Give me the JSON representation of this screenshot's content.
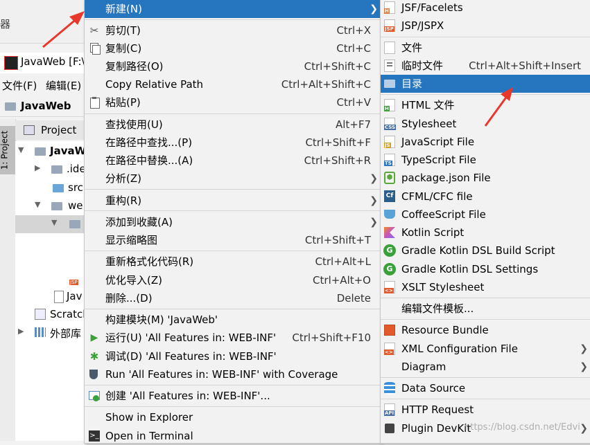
{
  "ide": {
    "top_label": "器",
    "title": "JavaWeb [F:\\",
    "menu_file": "文件(F)",
    "menu_edit": "编辑(E)",
    "nav_project": "JavaWeb",
    "project_tab": "Project",
    "stripe_label": "1: Project",
    "tree": {
      "root": "JavaW",
      "idea": ".ide",
      "src": "src",
      "web": "we",
      "java_file": "Jav",
      "scratches": "Scratch",
      "external_libs": "外部库"
    }
  },
  "context_menu": {
    "items": [
      {
        "label": "新建(N)",
        "submenu": true,
        "selected": true
      },
      {
        "label": "剪切(T)",
        "shortcut": "Ctrl+X",
        "icon": "scissors-icon"
      },
      {
        "label": "复制(C)",
        "shortcut": "Ctrl+C",
        "icon": "copy-icon"
      },
      {
        "label": "复制路径(O)",
        "shortcut": "Ctrl+Shift+C"
      },
      {
        "label": "Copy Relative Path",
        "shortcut": "Ctrl+Alt+Shift+C"
      },
      {
        "label": "粘贴(P)",
        "shortcut": "Ctrl+V",
        "icon": "paste-icon"
      },
      {
        "label": "查找使用(U)",
        "shortcut": "Alt+F7"
      },
      {
        "label": "在路径中查找...(P)",
        "shortcut": "Ctrl+Shift+F"
      },
      {
        "label": "在路径中替换...(A)",
        "shortcut": "Ctrl+Shift+R"
      },
      {
        "label": "分析(Z)",
        "submenu": true
      },
      {
        "label": "重构(R)",
        "submenu": true
      },
      {
        "label": "添加到收藏(A)",
        "submenu": true
      },
      {
        "label": "显示缩略图",
        "shortcut": "Ctrl+Shift+T"
      },
      {
        "label": "重新格式化代码(R)",
        "shortcut": "Ctrl+Alt+L"
      },
      {
        "label": "优化导入(Z)",
        "shortcut": "Ctrl+Alt+O"
      },
      {
        "label": "删除...(D)",
        "shortcut": "Delete"
      },
      {
        "label": "构建模块(M) 'JavaWeb'"
      },
      {
        "label": "运行(U) 'All Features in: WEB-INF'",
        "shortcut": "Ctrl+Shift+F10",
        "icon": "run-icon"
      },
      {
        "label": "调试(D) 'All Features in: WEB-INF'",
        "icon": "debug-icon"
      },
      {
        "label": "Run 'All Features in: WEB-INF' with Coverage",
        "icon": "coverage-icon"
      },
      {
        "label": "创建 'All Features in: WEB-INF'...",
        "icon": "create-config-icon"
      },
      {
        "label": "Show in Explorer"
      },
      {
        "label": "Open in Terminal",
        "icon": "terminal-icon"
      }
    ]
  },
  "new_submenu": {
    "items": [
      {
        "label": "JSF/Facelets",
        "icon": "html-file-icon"
      },
      {
        "label": "JSP/JSPX",
        "icon": "jsp-file-icon"
      },
      {
        "label": "文件",
        "icon": "file-icon"
      },
      {
        "label": "临时文件",
        "shortcut": "Ctrl+Alt+Shift+Insert",
        "icon": "scratch-file-icon"
      },
      {
        "label": "目录",
        "icon": "folder-icon",
        "selected": true
      },
      {
        "label": "HTML 文件",
        "icon": "html-file-icon"
      },
      {
        "label": "Stylesheet",
        "icon": "css-file-icon"
      },
      {
        "label": "JavaScript File",
        "icon": "js-file-icon"
      },
      {
        "label": "TypeScript File",
        "icon": "ts-file-icon"
      },
      {
        "label": "package.json File",
        "icon": "nodejs-icon"
      },
      {
        "label": "CFML/CFC file",
        "icon": "cfml-icon"
      },
      {
        "label": "CoffeeScript File",
        "icon": "coffeescript-icon"
      },
      {
        "label": "Kotlin Script",
        "icon": "kotlin-icon"
      },
      {
        "label": "Gradle Kotlin DSL Build Script",
        "icon": "gradle-icon"
      },
      {
        "label": "Gradle Kotlin DSL Settings",
        "icon": "gradle-icon"
      },
      {
        "label": "XSLT Stylesheet",
        "icon": "xslt-icon"
      },
      {
        "label": "编辑文件模板..."
      },
      {
        "label": "Resource Bundle",
        "icon": "resource-bundle-icon"
      },
      {
        "label": "XML Configuration File",
        "icon": "xml-icon",
        "submenu": true
      },
      {
        "label": "Diagram",
        "submenu": true
      },
      {
        "label": "Data Source",
        "icon": "database-icon"
      },
      {
        "label": "HTTP Request",
        "icon": "api-icon"
      },
      {
        "label": "Plugin DevKit",
        "icon": "plugin-icon"
      }
    ]
  },
  "watermark": "https://blog.csdn.net/Edvi",
  "colors": {
    "selection": "#2675bf",
    "menu_bg": "#f2f2f2",
    "annotation_arrow": "#e8382c"
  }
}
